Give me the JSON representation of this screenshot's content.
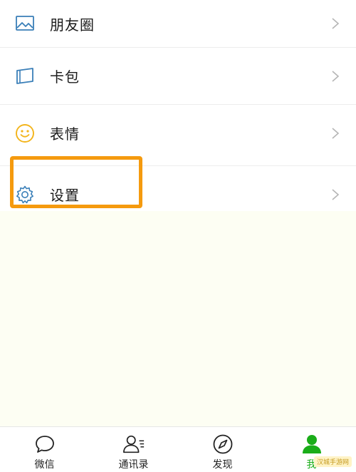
{
  "menu": {
    "items": [
      {
        "label": "朋友圈",
        "icon": "photo-icon"
      },
      {
        "label": "卡包",
        "icon": "card-icon"
      },
      {
        "label": "表情",
        "icon": "smiley-icon"
      },
      {
        "label": "设置",
        "icon": "gear-icon",
        "highlighted": true
      }
    ]
  },
  "tabbar": {
    "tabs": [
      {
        "label": "微信",
        "icon": "chat-bubble-icon"
      },
      {
        "label": "通讯录",
        "icon": "contacts-icon"
      },
      {
        "label": "发现",
        "icon": "compass-icon"
      },
      {
        "label": "我",
        "icon": "person-icon",
        "active": true
      }
    ]
  },
  "watermark": {
    "text": "汉城手游网"
  },
  "colors": {
    "accent_green": "#1aad19",
    "highlight_orange": "#f59a0e",
    "icon_blue": "#3a7fb8",
    "icon_yellow": "#f3b41a"
  }
}
